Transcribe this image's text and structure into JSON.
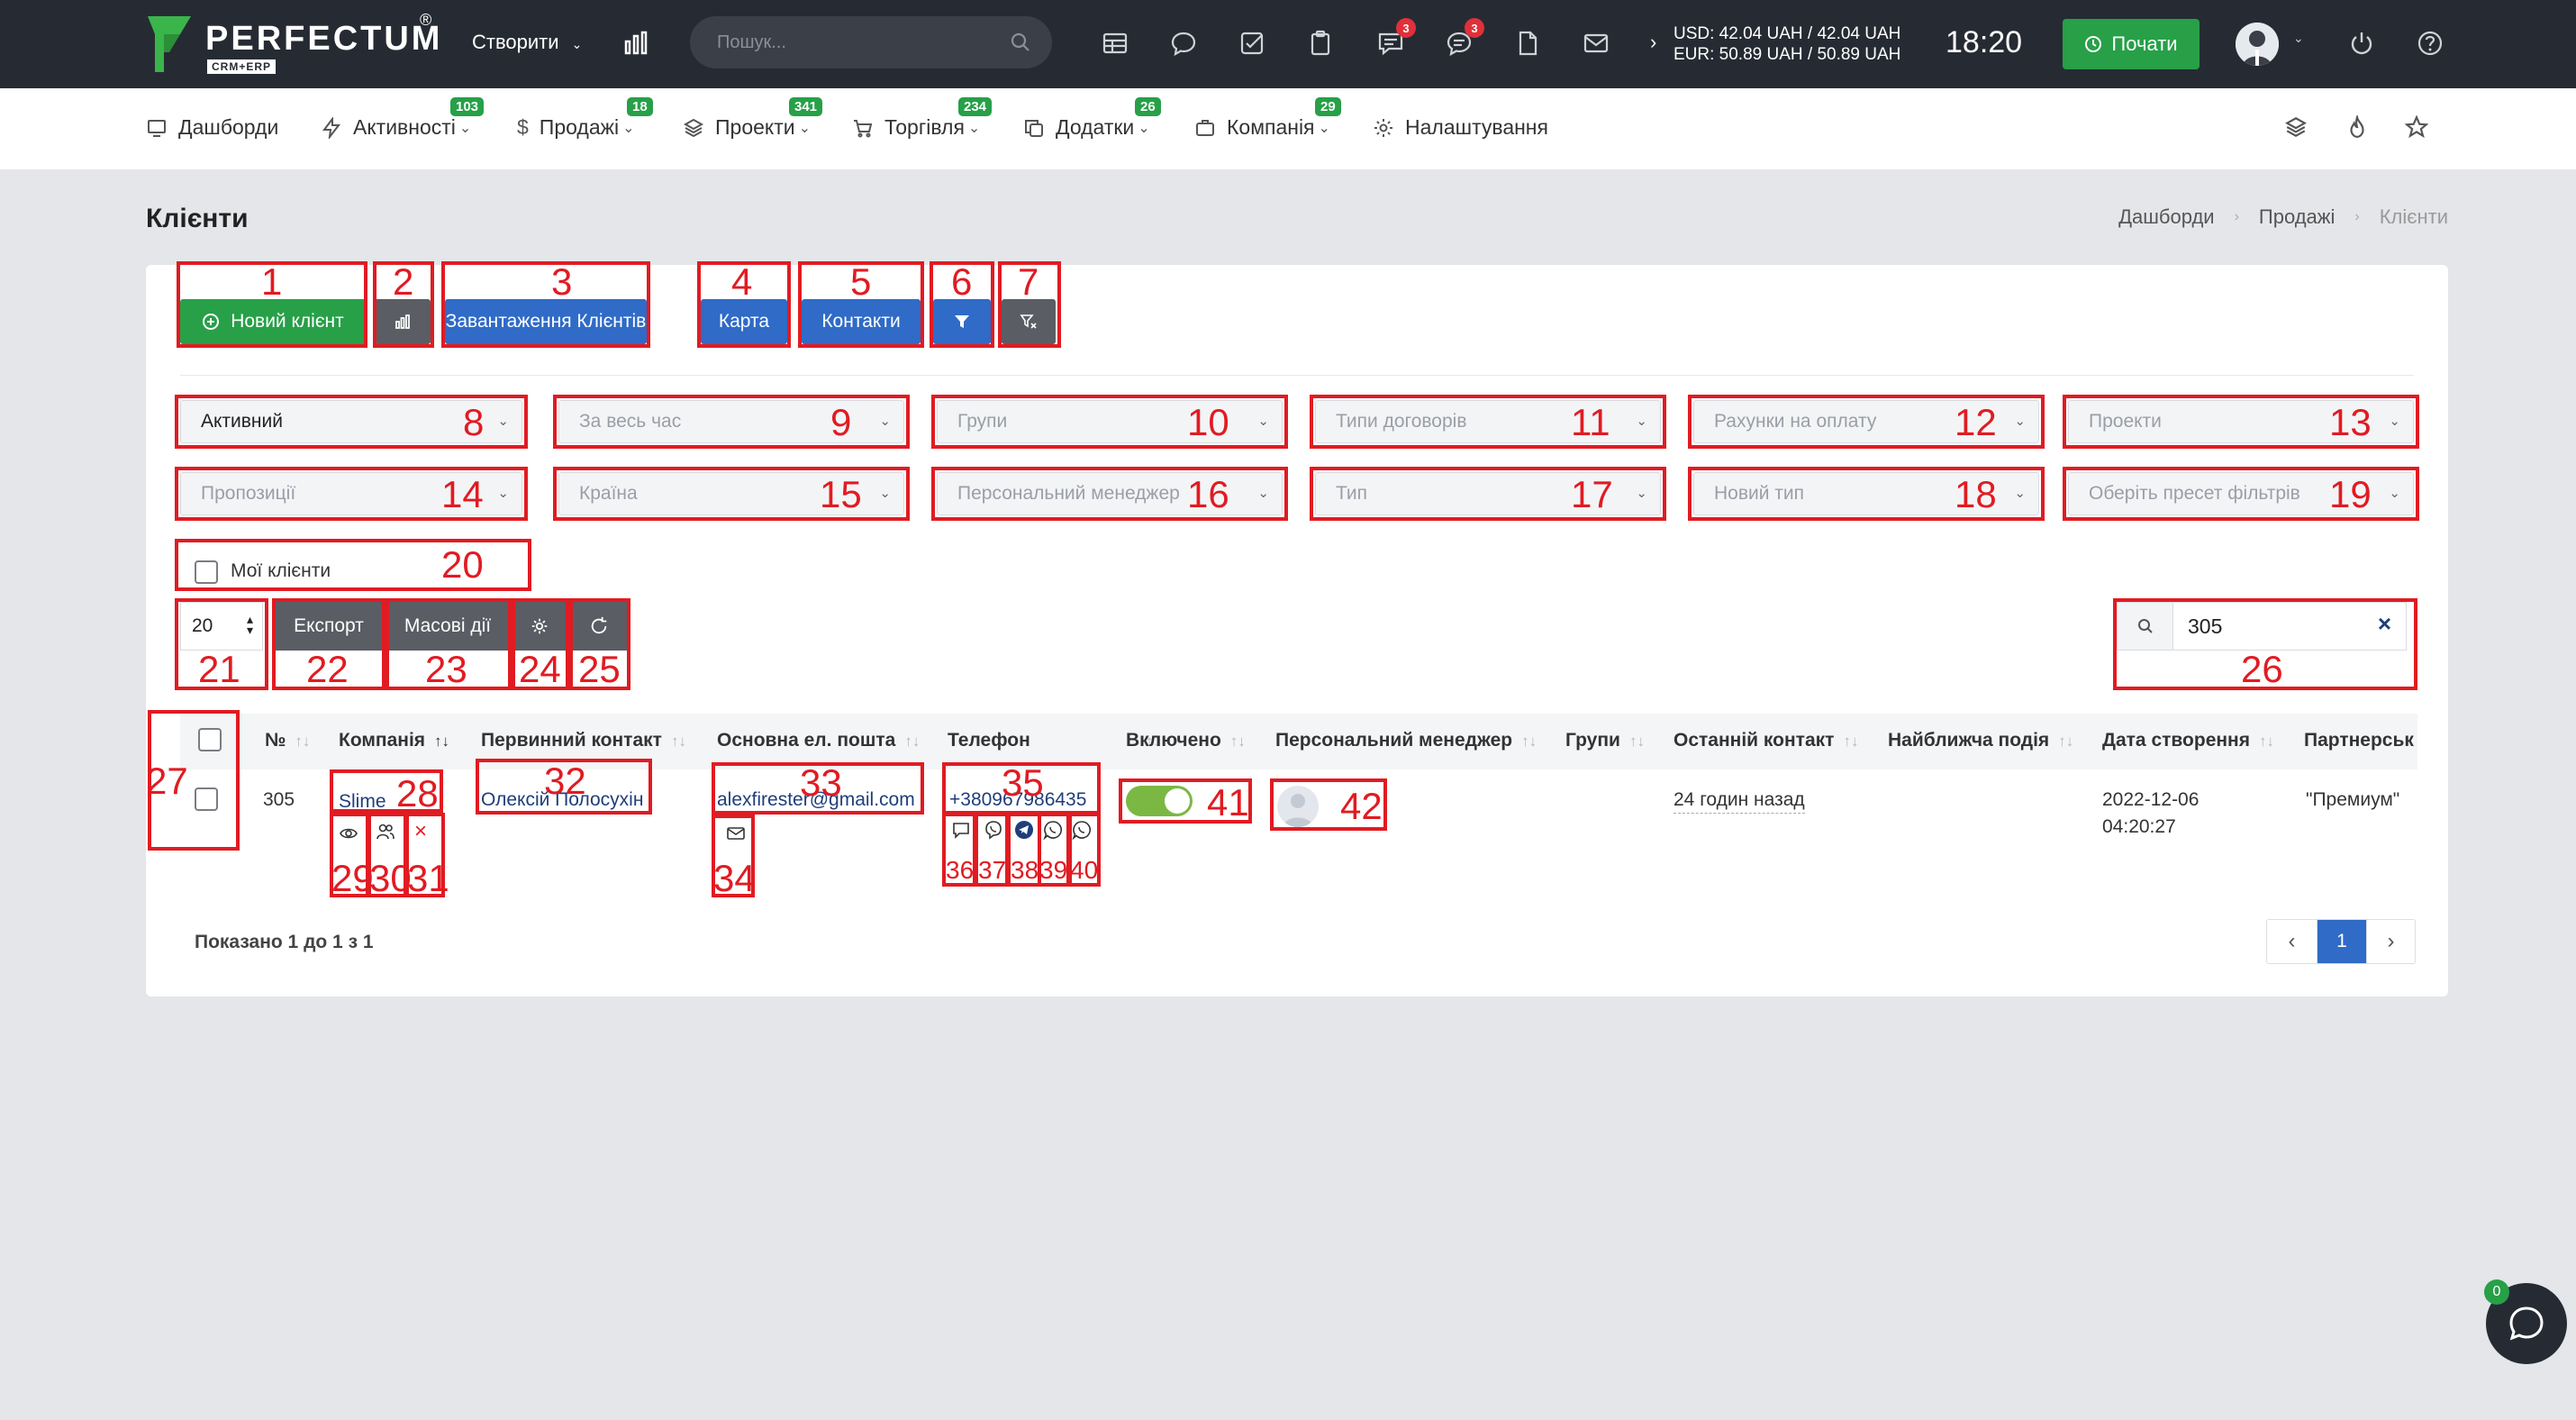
{
  "topbar": {
    "brand": "PERFECTUM",
    "brand_reg": "®",
    "brand_sub": "CRM+ERP",
    "create_label": "Створити",
    "search_placeholder": "Пошук...",
    "notifications_badge": "3",
    "messages_badge": "3",
    "currency_usd": "USD: 42.04 UAH / 42.04 UAH",
    "currency_eur": "EUR: 50.89 UAH / 50.89 UAH",
    "time": "18:20",
    "start_label": "Почати"
  },
  "nav": {
    "dashboards": "Дашборди",
    "activities": "Активності",
    "activities_badge": "103",
    "sales": "Продажі",
    "sales_badge": "18",
    "projects": "Проекти",
    "projects_badge": "341",
    "trade": "Торгівля",
    "trade_badge": "234",
    "addons": "Додатки",
    "addons_badge": "26",
    "company": "Компанія",
    "company_badge": "29",
    "settings": "Налаштування"
  },
  "page": {
    "title": "Клієнти",
    "breadcrumb": [
      "Дашборди",
      "Продажі",
      "Клієнти"
    ]
  },
  "toolbar": {
    "new_client": "Новий клієнт",
    "upload_clients": "Завантаження Клієнтів",
    "map": "Карта",
    "contacts": "Контакти"
  },
  "filters": {
    "status": "Активний",
    "period": "За весь час",
    "groups": "Групи",
    "contract_types": "Типи договорів",
    "invoices": "Рахунки на оплату",
    "projects": "Проекти",
    "proposals": "Пропозиції",
    "country": "Країна",
    "manager": "Персональний менеджер",
    "type": "Тип",
    "new_type": "Новий тип",
    "preset": "Оберіть пресет фільтрів",
    "my_clients": "Мої клієнти"
  },
  "table_controls": {
    "page_size": "20",
    "export": "Експорт",
    "bulk": "Масові дії",
    "search_value": "305"
  },
  "table": {
    "headers": [
      "№",
      "Компанія",
      "Первинний контакт",
      "Основна ел. пошта",
      "Телефон",
      "Включено",
      "Персональний менеджер",
      "Групи",
      "Останній контакт",
      "Найближча подія",
      "Дата створення",
      "Партнерськ"
    ],
    "row": {
      "id": "305",
      "company": "Slime",
      "contact": "Олексій Полосухін",
      "email": "alexfirester@gmail.com",
      "phone": "+380967986435",
      "enabled": true,
      "last_contact": "24 годин назад",
      "created_date": "2022-12-06",
      "created_time": "04:20:27",
      "partner": "\"Премиум\""
    },
    "shown": "Показано 1 до 1 з 1",
    "current_page": "1"
  },
  "chat": {
    "badge": "0"
  },
  "annotations": [
    "1",
    "2",
    "3",
    "4",
    "5",
    "6",
    "7",
    "8",
    "9",
    "10",
    "11",
    "12",
    "13",
    "14",
    "15",
    "16",
    "17",
    "18",
    "19",
    "20",
    "21",
    "22",
    "23",
    "24",
    "25",
    "26",
    "27",
    "28",
    "29",
    "30",
    "31",
    "32",
    "33",
    "34",
    "35",
    "36",
    "37",
    "38",
    "39",
    "40",
    "41",
    "42"
  ],
  "colors": {
    "annotation": "#e11b22",
    "green": "#27a048",
    "blue": "#2f6bc7",
    "topbar": "#262b33"
  }
}
